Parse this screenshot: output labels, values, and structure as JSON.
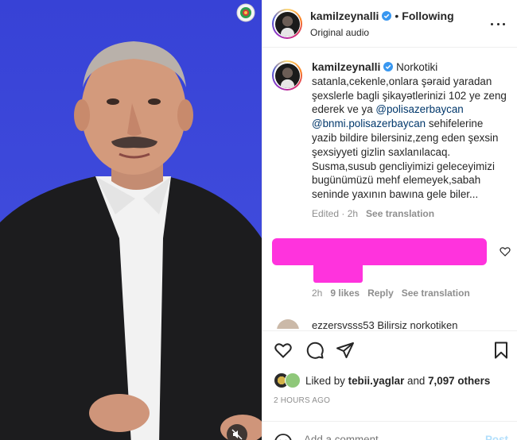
{
  "post": {
    "username": "kamilzeynalli",
    "follow_status": "Following",
    "audio": "Original audio"
  },
  "caption": {
    "username": "kamilzeynalli",
    "text_1": "Norkotiki satanla,cekenle,onlara şəraid yaradan şexslerle bagli şikayətlerinizi 102 ye zeng ederek ve ya ",
    "mention_1": "@polisazerbaycan",
    "mention_2": "@bnmi.polisazerbaycan",
    "text_2": " sehifelerine yazib bildire bilersiniz,zeng eden şexsin şexsiyyeti gizlin saxlanılacaq. Susma,susub gencliyimizi geleceyimizi bugünümüzü mehf elemeyek,sabah seninde yaxının bawına gele biler...",
    "edited": "Edited · 2h",
    "see_translation": "See translation"
  },
  "comment": {
    "time": "2h",
    "likes": "9 likes",
    "reply": "Reply",
    "see_translation": "See translation"
  },
  "next_comment": {
    "text": "ezzersvsss53  Bilirsiz norkotiken"
  },
  "likes": {
    "prefix": "Liked by ",
    "user": "tebii.yaglar",
    "middle": " and ",
    "others": "7,097 others"
  },
  "time_ago": "2 HOURS AGO",
  "add_comment": {
    "placeholder": "Add a comment...",
    "post_label": "Post"
  },
  "colors": {
    "media_bg": "#3d48d8",
    "redaction": "#ff33dd",
    "verified": "#3897f0",
    "mention": "#00376b"
  }
}
